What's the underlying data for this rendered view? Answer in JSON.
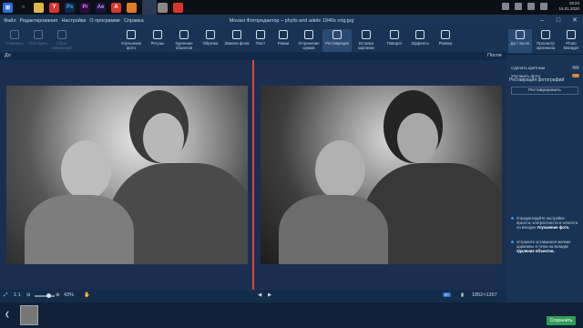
{
  "window": {
    "title": "Movavi Фоторедактор – phylis and adele 1940s orig.jpg"
  },
  "taskbar": {
    "apps": [
      "windows-icon",
      "search-icon",
      "folder-icon",
      "yandex-browser-icon",
      "photoshop-icon",
      "premiere-icon",
      "after-effects-icon",
      "acrobat-icon",
      "firefox-icon",
      "movavi-icon",
      "unknown-app-icon",
      "movavi-photo-editor-icon"
    ],
    "time": "19:24",
    "date": "16.01.2020"
  },
  "menu": [
    "Файл",
    "Редактирование",
    "Настройки",
    "О программе",
    "Справка"
  ],
  "toolbar": {
    "left": [
      {
        "label": "Отменить",
        "icon": "undo-icon",
        "enabled": false
      },
      {
        "label": "Повторить",
        "icon": "redo-icon",
        "enabled": false
      },
      {
        "label": "Сброс изменений",
        "icon": "reset-icon",
        "enabled": false
      }
    ],
    "tools": [
      {
        "label": "Улучшение фото",
        "icon": "enhance-icon"
      },
      {
        "label": "Ретушь",
        "icon": "retouch-icon"
      },
      {
        "label": "Удаление объектов",
        "icon": "object-removal-icon"
      },
      {
        "label": "Обрезка",
        "icon": "crop-icon"
      },
      {
        "label": "Замена фона",
        "icon": "background-icon"
      },
      {
        "label": "Текст",
        "icon": "text-icon"
      },
      {
        "label": "Рамки",
        "icon": "frames-icon"
      },
      {
        "label": "Устранение шумов",
        "icon": "denoise-icon"
      },
      {
        "label": "Реставрация",
        "icon": "restoration-icon",
        "selected": true
      },
      {
        "label": "Вставка картинки",
        "icon": "insert-image-icon"
      },
      {
        "label": "Поворот",
        "icon": "rotate-icon"
      },
      {
        "label": "Эффекты",
        "icon": "effects-icon"
      },
      {
        "label": "Размер",
        "icon": "resize-icon"
      }
    ],
    "right": [
      {
        "label": "До / после",
        "icon": "before-after-icon",
        "selected": true
      },
      {
        "label": "Просмотр оригинала",
        "icon": "eye-icon"
      },
      {
        "label": "Photo Manager",
        "icon": "photo-manager-icon"
      }
    ]
  },
  "compare": {
    "before": "До",
    "after": "После"
  },
  "panel": {
    "title": "Реставрация фотографий",
    "option1": "Сделать цветным",
    "option1_on": false,
    "option2": "Улучшить фото",
    "option2_on": true,
    "button": "Реставрировать",
    "tip1": "Отредактируйте настройки яркости, контрастности и четкости на вкладке",
    "tip1_bold": "Улучшение фото.",
    "tip2": "Устраните оставшиеся мелкие царапины и точки на вкладке",
    "tip2_bold": "Удаление объектов.",
    "dont_show": "Больше не показывать"
  },
  "bottom": {
    "fit": "1:1",
    "zoom": "43%",
    "zoom_fraction": 0.43,
    "dimensions": "1852×1357"
  },
  "save_label": "Сохранить"
}
